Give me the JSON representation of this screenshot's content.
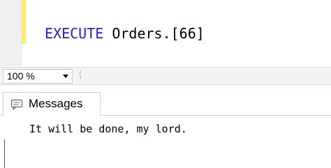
{
  "editor": {
    "keyword": "EXECUTE",
    "statement": " Orders.[66]",
    "change_bar_color": "#ffee62",
    "keyword_color": "#1f1fe0"
  },
  "zoom": {
    "value": "100 %"
  },
  "results": {
    "tab_label": "Messages",
    "tab_icon": "messages-icon",
    "message": "It will be done, my lord."
  }
}
